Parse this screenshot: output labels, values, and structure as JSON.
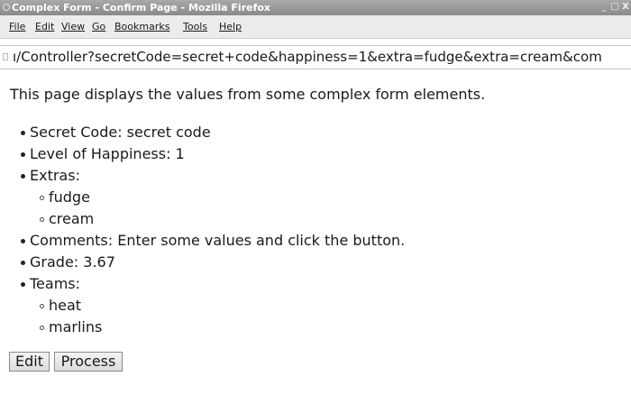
{
  "window": {
    "title": "Complex Form - Confirm Page - Mozilla Firefox",
    "controls": [
      "_",
      "□",
      "X"
    ]
  },
  "menubar": {
    "items": [
      "File",
      "Edit",
      "View",
      "Go",
      "Bookmarks",
      "Tools",
      "Help"
    ]
  },
  "urlbar": {
    "url": "ı/Controller?secretCode=secret+code&happiness=1&extra=fudge&extra=cream&com"
  },
  "page": {
    "intro": "This page displays the values from some complex form elements.",
    "items": [
      "Secret Code: secret code",
      "Level of Happiness: 1",
      "Extras:",
      "Comments: Enter some values and click the button.",
      "Grade: 3.67",
      "Teams:"
    ],
    "extras": [
      "fudge",
      "cream"
    ],
    "teams": [
      "heat",
      "marlins"
    ],
    "buttons": {
      "edit": "Edit",
      "process": "Process"
    }
  }
}
